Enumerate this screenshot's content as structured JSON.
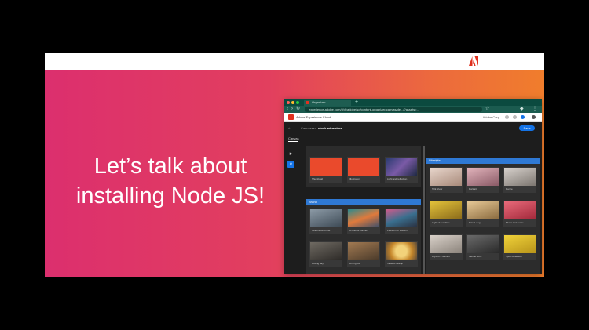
{
  "slide": {
    "headline_line1": "Let’s talk about",
    "headline_line2": "installing Node JS!",
    "logo_icon": "adobe-logo-icon",
    "gradient_colors": [
      "#dc2f6e",
      "#ec6a3d",
      "#f07d2c"
    ]
  },
  "browser": {
    "tab_title": "Organizer",
    "url": "experience.adobe.com/#/@adobe/so/content-organizer/canvas/de.../?assets=...",
    "app_title": "Adobe Experience Cloud",
    "user_label": "Adobe Corp",
    "breadcrumb": [
      "Canvases",
      "stock-adventure"
    ],
    "save_label": "Save",
    "canvas_tab": "Canvas",
    "panels": [
      {
        "label": "",
        "cards": [
          {
            "caption": "Thumbnail",
            "color": "#ea4a2c"
          },
          {
            "caption": "Illustration",
            "color": "#ea4a2c"
          },
          {
            "caption": "Light and reflection",
            "color": "#3a3f63"
          }
        ]
      },
      {
        "label": "Brand",
        "cards": [
          {
            "caption": "Celebration of life",
            "color": "#5d6a74"
          },
          {
            "caption": "A colorful portrait",
            "color": "#4e6f7d"
          },
          {
            "caption": "Fashion for women",
            "color": "#46566a"
          },
          {
            "caption": "Boxing day",
            "color": "#6c6458"
          },
          {
            "caption": "Dining out",
            "color": "#8a6b4e"
          },
          {
            "caption": "Taste of design",
            "color": "#c5a451"
          }
        ]
      },
      {
        "label": "Lifestyle",
        "cards": [
          {
            "caption": "Talk show",
            "color": "#c9b3a8"
          },
          {
            "caption": "Portrait",
            "color": "#d0a0a8"
          },
          {
            "caption": "Dance",
            "color": "#b9b2ad"
          },
          {
            "caption": "Light of sunshine",
            "color": "#c9a32a"
          },
          {
            "caption": "Travel vlog",
            "color": "#c8aa74"
          },
          {
            "caption": "Music and dance",
            "color": "#d44a5a"
          },
          {
            "caption": "Light of a fashion",
            "color": "#b0a79e"
          },
          {
            "caption": "Men at work",
            "color": "#4a4a4a"
          },
          {
            "caption": "Spirit of fashion",
            "color": "#d6b62c"
          }
        ]
      }
    ]
  }
}
